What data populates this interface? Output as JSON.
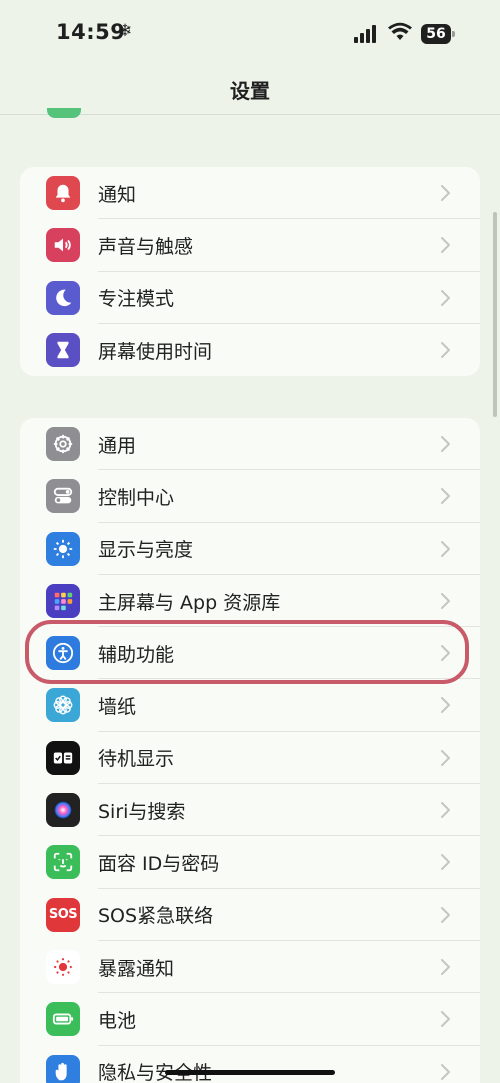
{
  "status": {
    "time": "14:59",
    "battery": "56"
  },
  "nav": {
    "title": "设置"
  },
  "group1": [
    {
      "label": "通知",
      "icon": "bell-icon",
      "color": "#e0484f"
    },
    {
      "label": "声音与触感",
      "icon": "speaker-icon",
      "color": "#d8415e"
    },
    {
      "label": "专注模式",
      "icon": "moon-icon",
      "color": "#5b5bd0"
    },
    {
      "label": "屏幕使用时间",
      "icon": "hourglass-icon",
      "color": "#5b4fc4"
    }
  ],
  "group2": [
    {
      "label": "通用",
      "icon": "gear-icon",
      "color": "#8e8e93"
    },
    {
      "label": "控制中心",
      "icon": "toggles-icon",
      "color": "#8e8e93"
    },
    {
      "label": "显示与亮度",
      "icon": "sun-icon",
      "color": "#2f7fe0"
    },
    {
      "label": "主屏幕与 App 资源库",
      "icon": "grid-icon",
      "color": "#4a3fc0"
    },
    {
      "label": "辅助功能",
      "icon": "accessibility-icon",
      "color": "#2e7bdf"
    },
    {
      "label": "墙纸",
      "icon": "flower-icon",
      "color": "#3aa7d6"
    },
    {
      "label": "待机显示",
      "icon": "standby-icon",
      "color": "#111111"
    },
    {
      "label": "Siri与搜索",
      "icon": "siri-icon",
      "color": "#222222"
    },
    {
      "label": "面容 ID与密码",
      "icon": "faceid-icon",
      "color": "#3bbd5a"
    },
    {
      "label": "SOS紧急联络",
      "icon": "sos-icon",
      "color": "#e0373b"
    },
    {
      "label": "暴露通知",
      "icon": "exposure-icon",
      "color": "#ffffff"
    },
    {
      "label": "电池",
      "icon": "battery-icon",
      "color": "#3bbd5a"
    },
    {
      "label": "隐私与安全性",
      "icon": "hand-icon",
      "color": "#2f7fe0"
    }
  ],
  "icons": {
    "sos_text": "SOS"
  }
}
